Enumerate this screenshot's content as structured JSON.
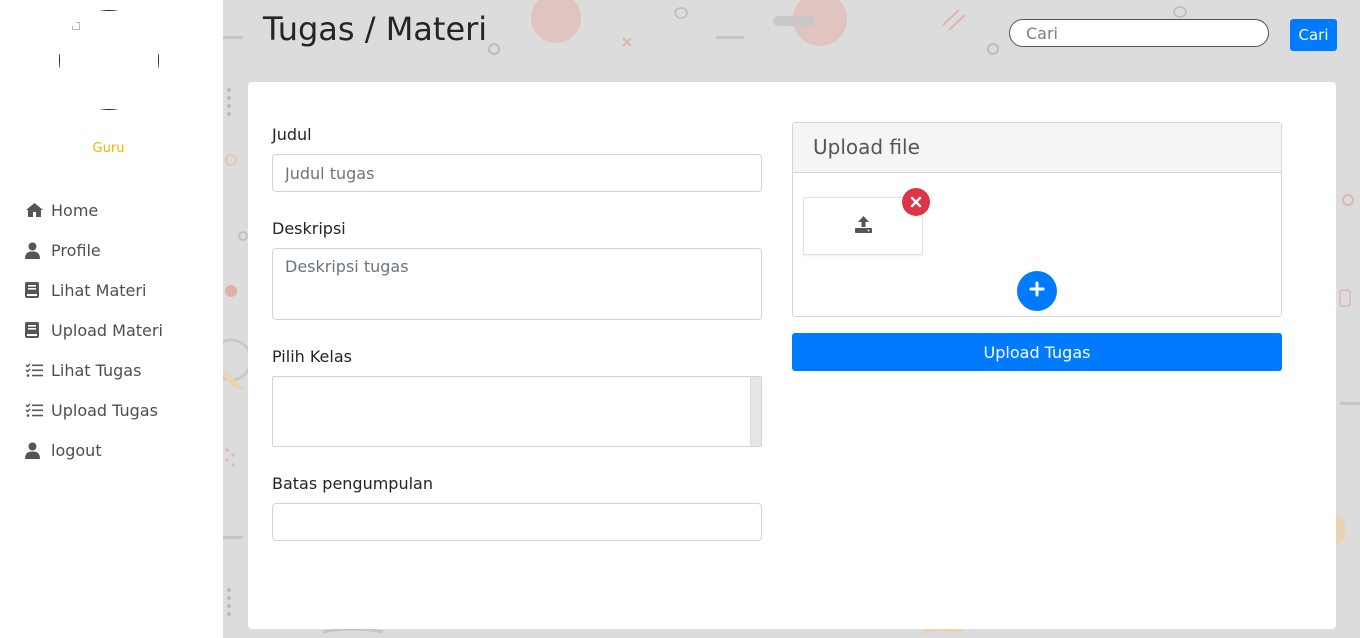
{
  "sidebar": {
    "role": "Guru",
    "items": [
      {
        "label": "Home",
        "icon": "home-icon"
      },
      {
        "label": "Profile",
        "icon": "user-icon"
      },
      {
        "label": "Lihat Materi",
        "icon": "book-icon"
      },
      {
        "label": "Upload Materi",
        "icon": "book-icon"
      },
      {
        "label": "Lihat Tugas",
        "icon": "tasks-icon"
      },
      {
        "label": "Upload Tugas",
        "icon": "tasks-icon"
      },
      {
        "label": "logout",
        "icon": "user-icon"
      }
    ]
  },
  "header": {
    "title": "Tugas / Materi",
    "search_placeholder": "Cari",
    "search_button": "Cari"
  },
  "form": {
    "judul_label": "Judul",
    "judul_placeholder": "Judul tugas",
    "deskripsi_label": "Deskripsi",
    "deskripsi_placeholder": "Deskripsi tugas",
    "kelas_label": "Pilih Kelas",
    "batas_label": "Batas pengumpulan"
  },
  "upload": {
    "header": "Upload file",
    "submit": "Upload Tugas"
  },
  "colors": {
    "primary": "#007bff",
    "danger": "#dc3545",
    "role": "#f0b400",
    "background": "#dcdcdc"
  }
}
